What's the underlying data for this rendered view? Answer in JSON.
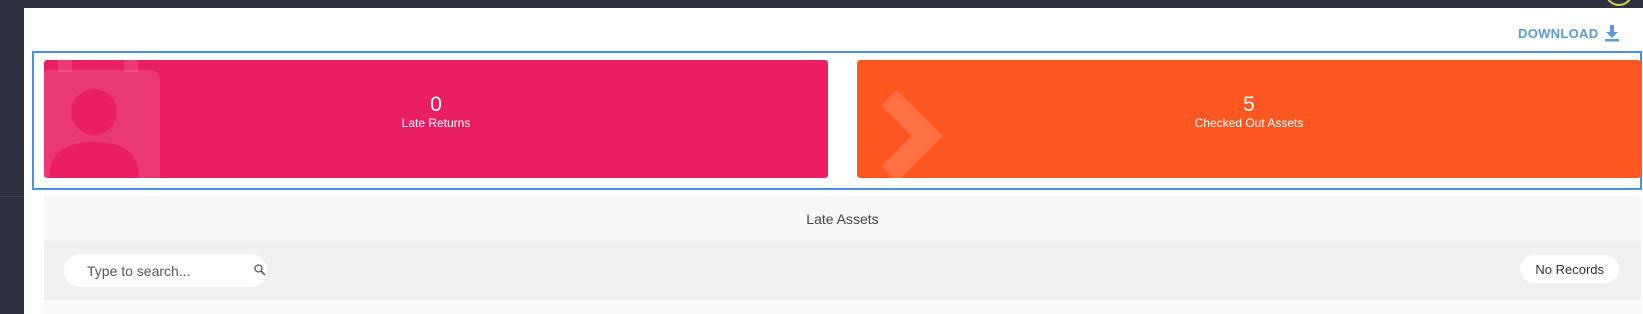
{
  "toolbar": {
    "download_label": "DOWNLOAD",
    "download_icon": "download-icon"
  },
  "cards": {
    "late_returns": {
      "count": "0",
      "label": "Late Returns",
      "color": "#e91e63",
      "icon": "person-badge-icon"
    },
    "checked_out": {
      "count": "5",
      "label": "Checked Out Assets",
      "color": "#ff5722",
      "icon": "chevron-right-icon"
    }
  },
  "late_assets": {
    "title": "Late Assets",
    "search_placeholder": "Type to search...",
    "records_label": "No Records"
  },
  "colors": {
    "accent": "#5b9bd5",
    "selection_border": "#4a90e2",
    "sidebar": "#2e3140"
  }
}
